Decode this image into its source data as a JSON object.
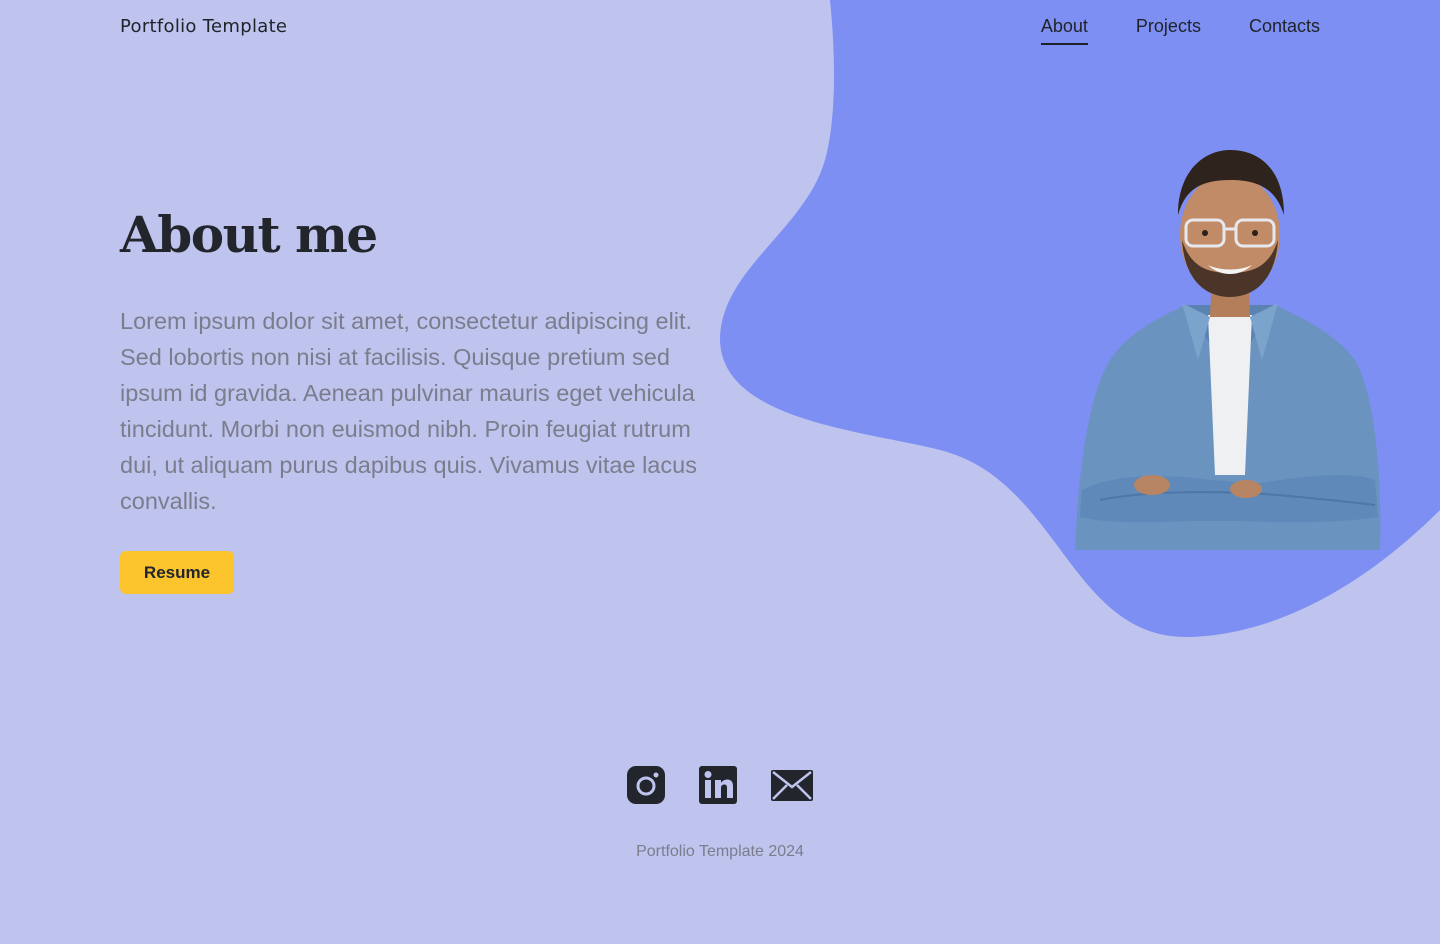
{
  "brand": "Portfolio Template",
  "nav": {
    "items": [
      {
        "label": "About",
        "active": true
      },
      {
        "label": "Projects",
        "active": false
      },
      {
        "label": "Contacts",
        "active": false
      }
    ]
  },
  "hero": {
    "heading": "About me",
    "bio": "Lorem ipsum dolor sit amet, consectetur adipiscing elit. Sed lobortis non nisi at facilisis. Quisque pretium sed ipsum id gravida. Aenean pulvinar mauris eget vehicula tincidunt. Morbi non euismod nibh. Proin feugiat rutrum dui, ut aliquam purus dapibus quis. Vivamus vitae lacus convallis.",
    "button_label": "Resume"
  },
  "socials": [
    "instagram-icon",
    "linkedin-icon",
    "mail-icon"
  ],
  "footer": "Portfolio Template 2024",
  "colors": {
    "background": "#bec4ee",
    "blob": "#7d8ff2",
    "accent": "#fbc42d",
    "text_dark": "#1f2329",
    "text_muted": "#7b7d8c"
  }
}
